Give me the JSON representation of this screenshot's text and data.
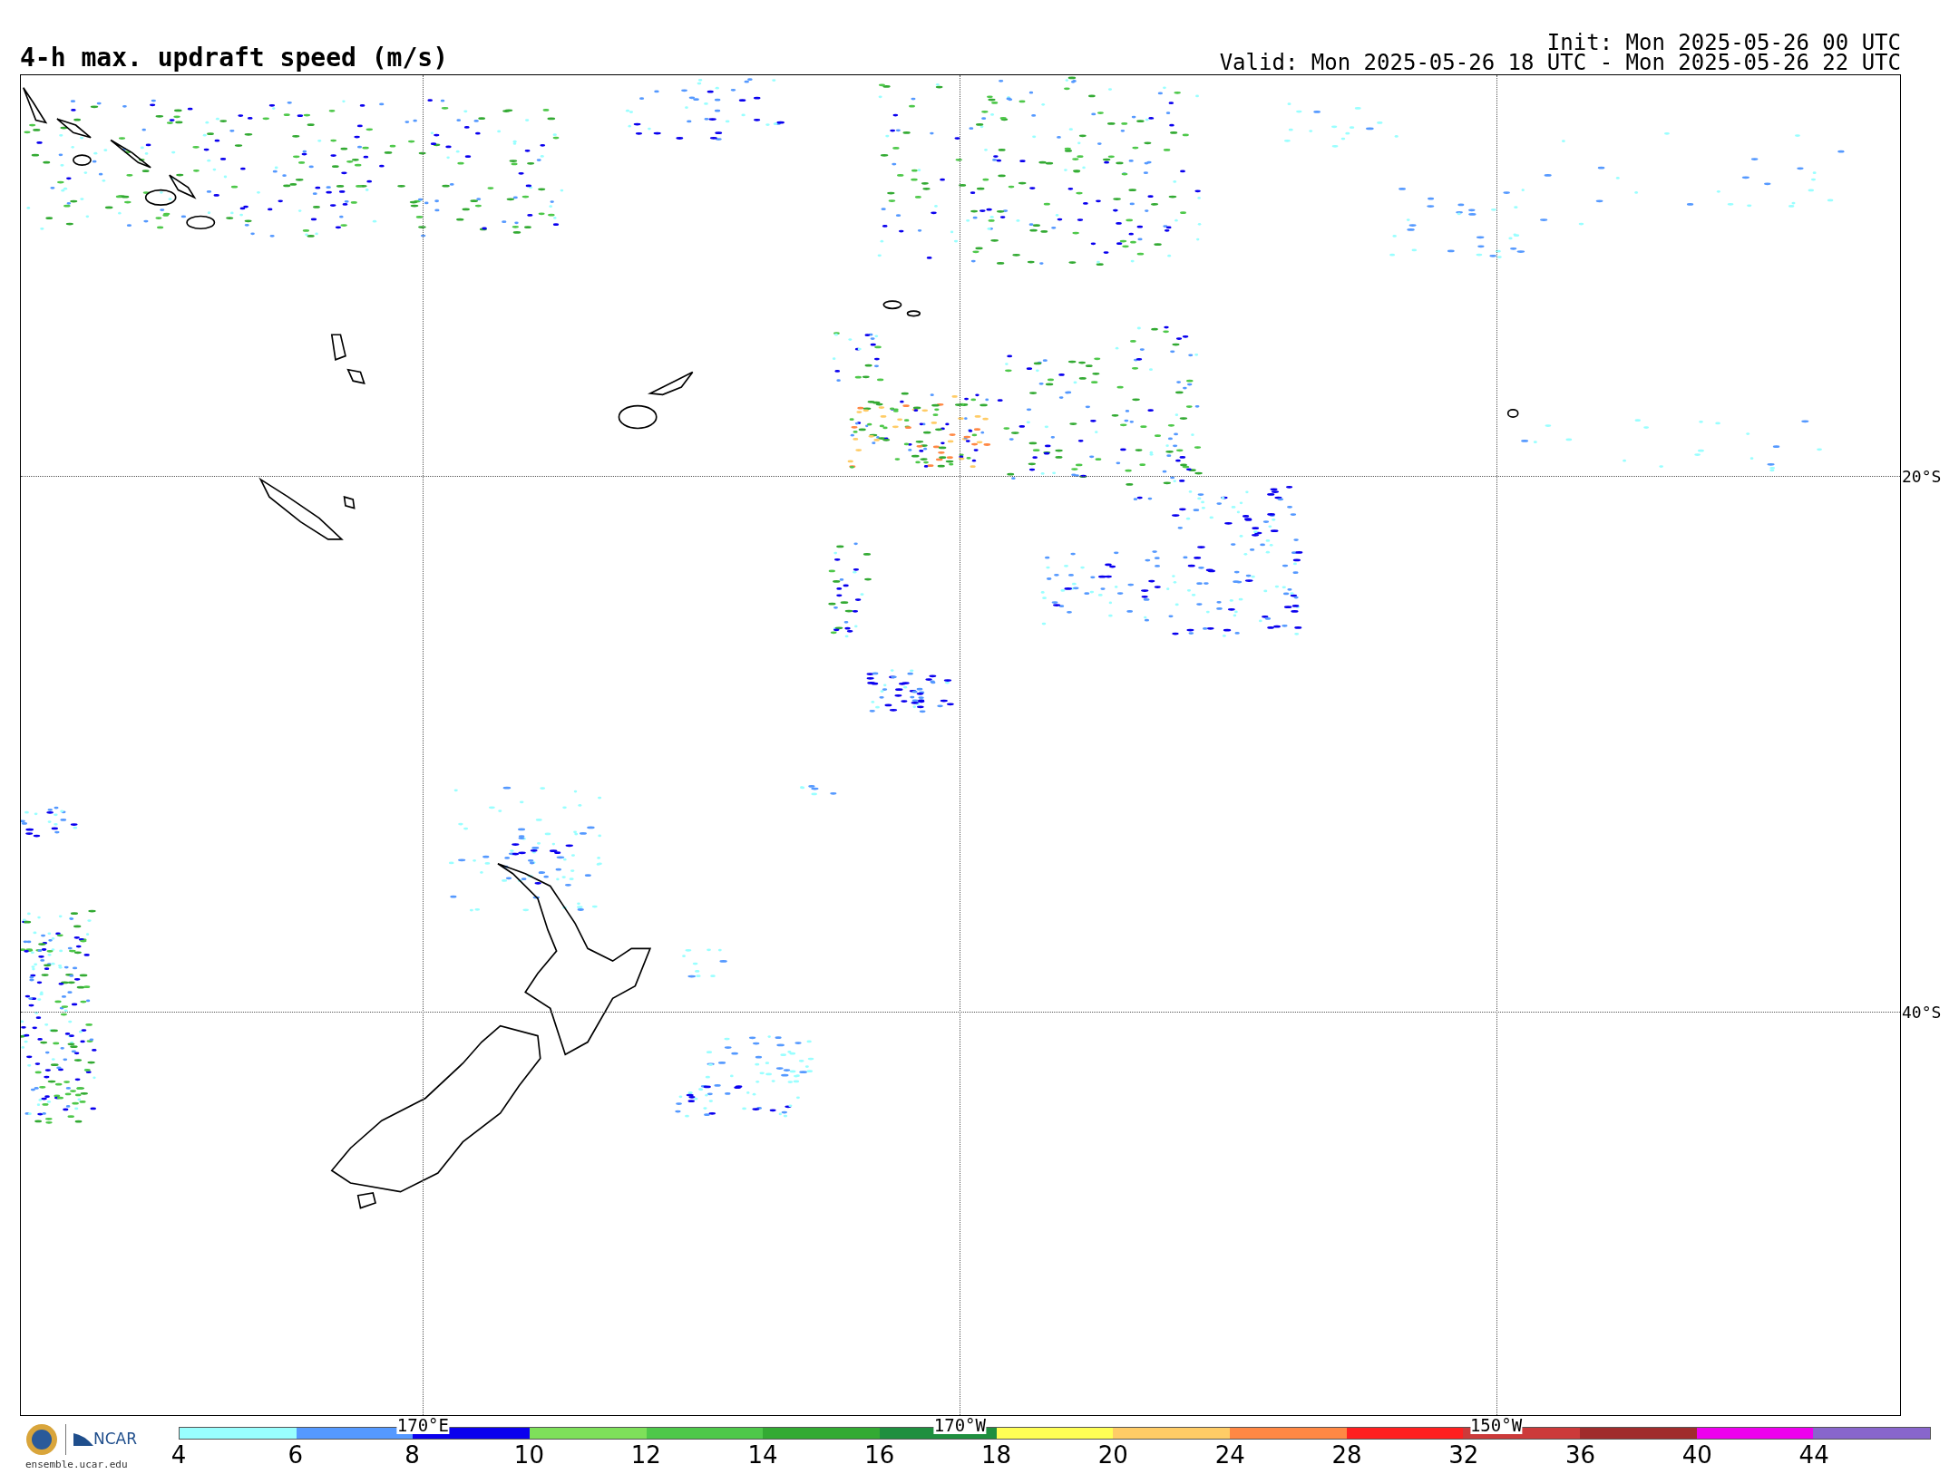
{
  "title": "4-h max. updraft speed (m/s)",
  "init": "Init: Mon 2025-05-26 00 UTC",
  "valid": "Valid: Mon 2025-05-26 18 UTC - Mon 2025-05-26 22 UTC",
  "lat_labels": [
    "20°S",
    "40°S"
  ],
  "lon_labels": [
    "170°E",
    "170°W",
    "150°W"
  ],
  "logo": {
    "name": "NCAR",
    "url": "ensemble.ucar.edu"
  },
  "colorbar": [
    {
      "label": "4",
      "color": "#99ffff"
    },
    {
      "label": "6",
      "color": "#5599ff"
    },
    {
      "label": "8",
      "color": "#0a00ee"
    },
    {
      "label": "10",
      "color": "#7ee05a"
    },
    {
      "label": "12",
      "color": "#4ec84a"
    },
    {
      "label": "14",
      "color": "#33aa33"
    },
    {
      "label": "16",
      "color": "#1f8f3f"
    },
    {
      "label": "18",
      "color": "#ffff55"
    },
    {
      "label": "20",
      "color": "#ffcc66"
    },
    {
      "label": "24",
      "color": "#ff8844"
    },
    {
      "label": "28",
      "color": "#ff2020"
    },
    {
      "label": "32",
      "color": "#cc3a3a"
    },
    {
      "label": "36",
      "color": "#a02c2c"
    },
    {
      "label": "40",
      "color": "#ee00ee"
    },
    {
      "label": "44",
      "color": "#8866cc"
    }
  ]
}
